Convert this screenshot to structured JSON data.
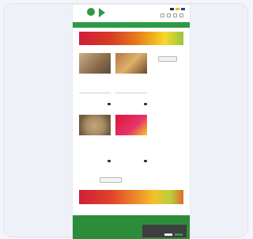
{
  "colors": {
    "brand_green": "#2e9a45",
    "banner_red": "#cf1f3a",
    "banner_yellow": "#f5da2c"
  },
  "header": {
    "logo_text": "",
    "icons": [
      "play-logo-icon",
      "flag-icon",
      "flag-icon",
      "flag-icon"
    ]
  },
  "nav": {
    "items": [
      "",
      "",
      "",
      "",
      ""
    ]
  },
  "articles": [
    {
      "title": "",
      "summary": ""
    },
    {
      "title": "",
      "summary": ""
    },
    {
      "title": "",
      "summary": ""
    },
    {
      "title": "",
      "summary": ""
    }
  ],
  "sidebar": {
    "title": "",
    "text": "",
    "button": ""
  },
  "load_more": "",
  "footer": {
    "logo_text": ""
  },
  "cookie": {
    "text": "",
    "accept": "",
    "decline": ""
  }
}
